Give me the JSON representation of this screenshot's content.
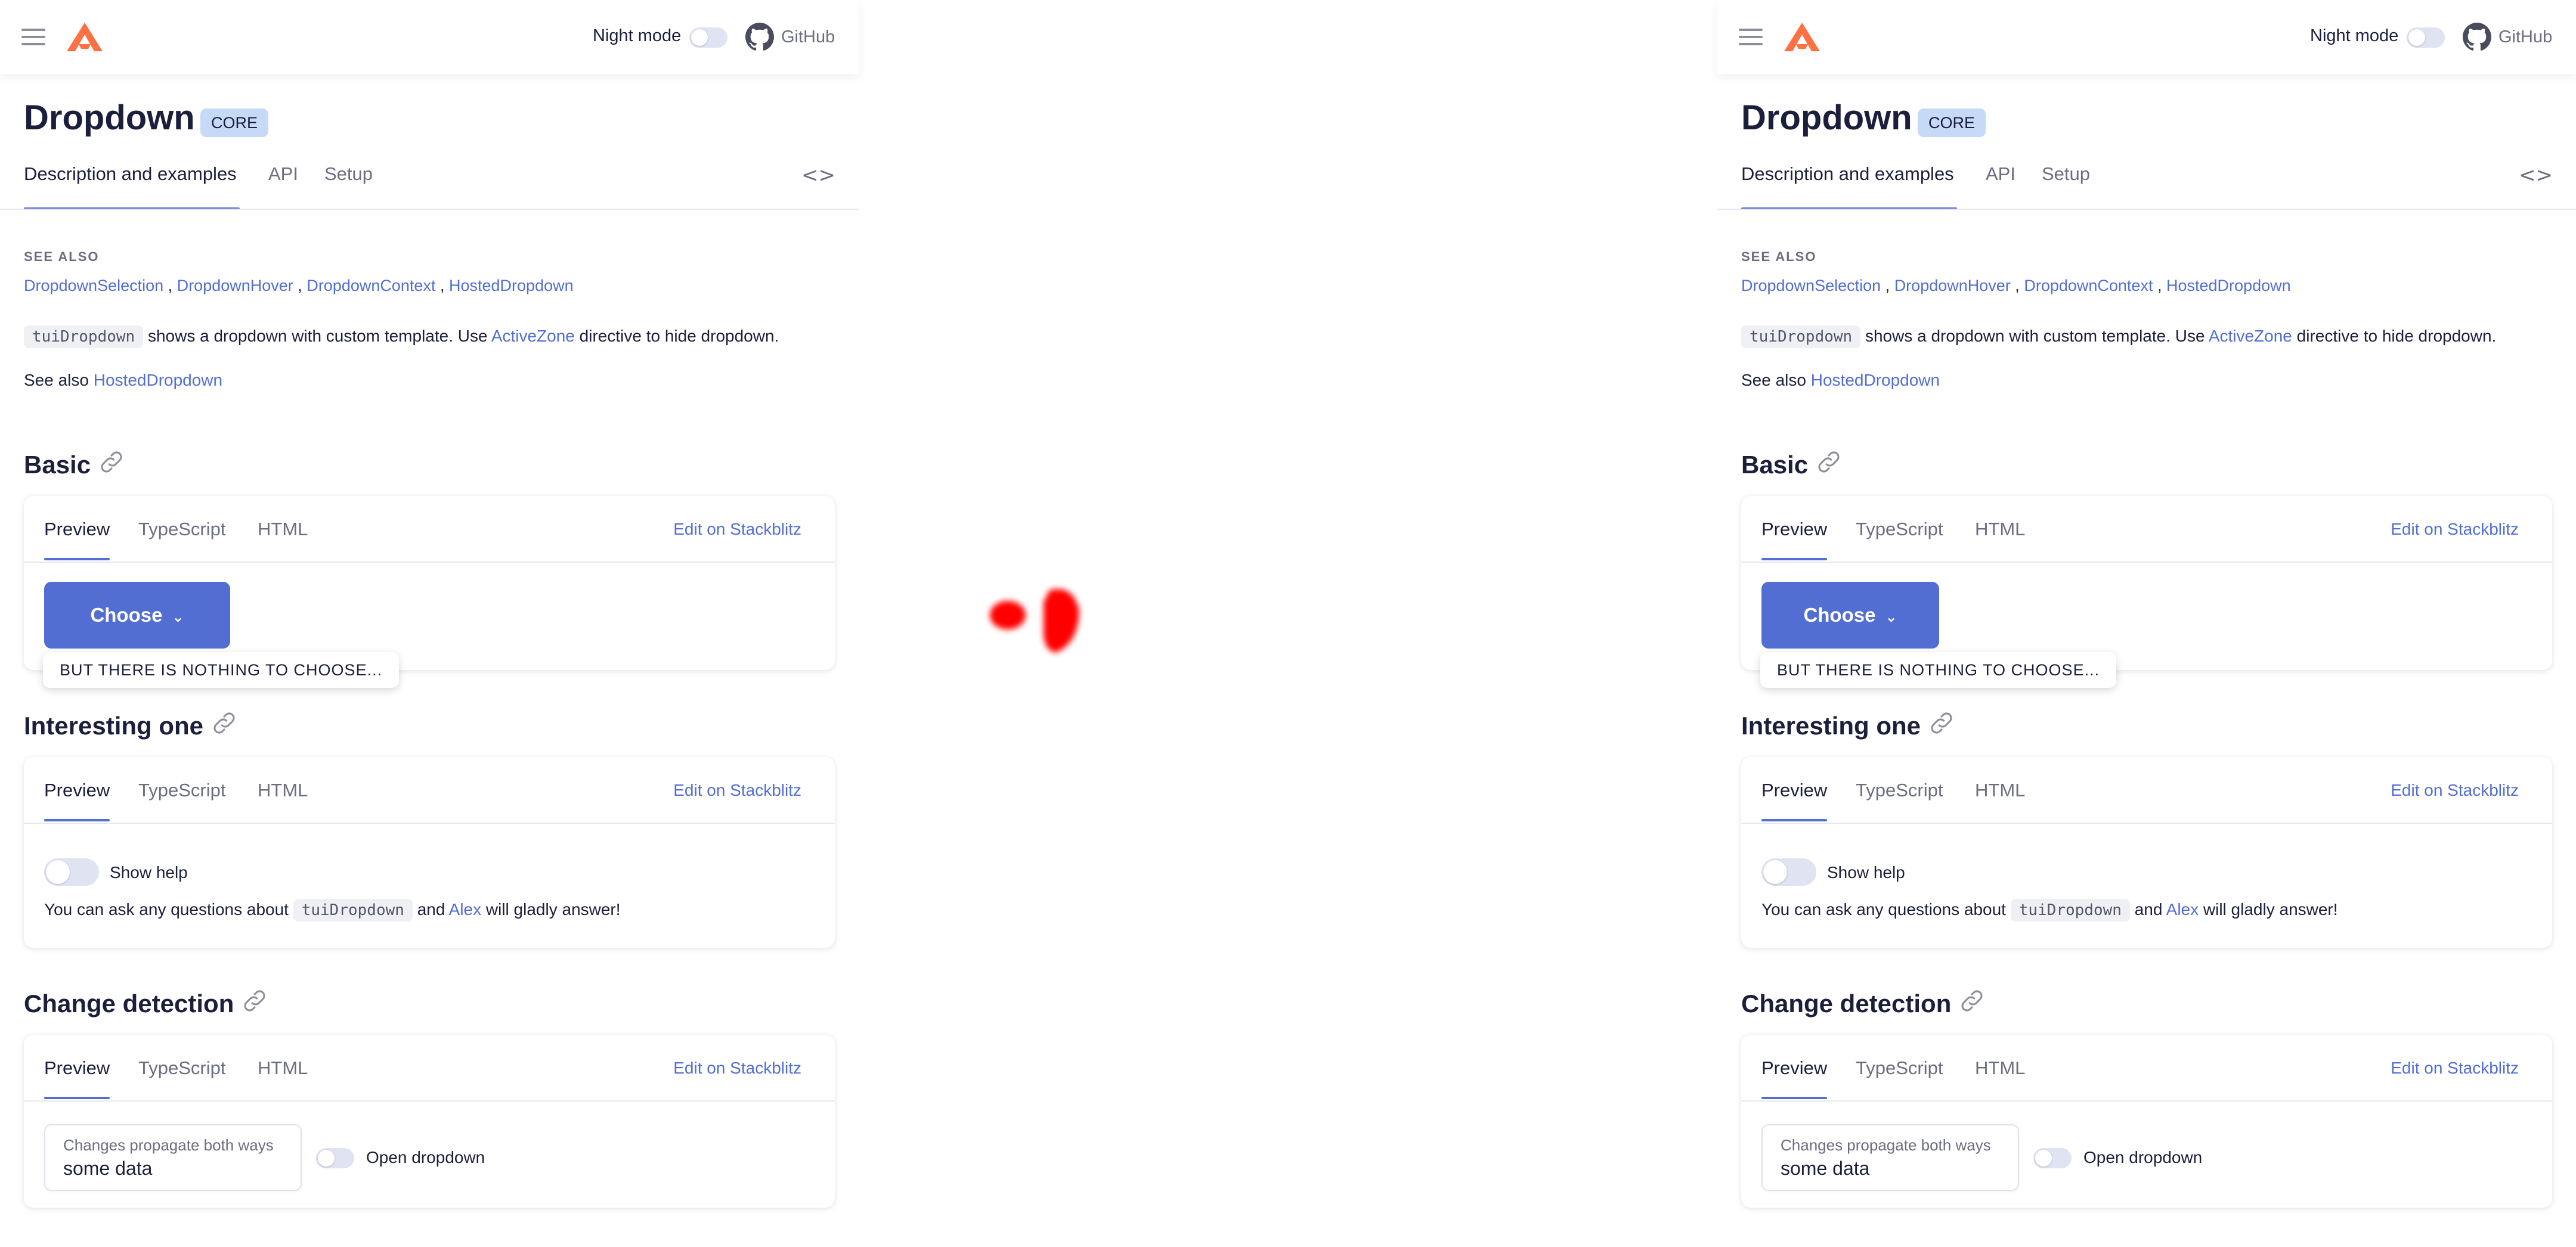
{
  "header": {
    "night_mode_label": "Night mode",
    "github_label": "GitHub"
  },
  "page": {
    "title": "Dropdown",
    "badge": "CORE",
    "tabs": [
      "Description and examples",
      "API",
      "Setup"
    ]
  },
  "see_also": {
    "heading": "SEE ALSO",
    "links": [
      "DropdownSelection",
      "DropdownHover",
      "DropdownContext",
      "HostedDropdown"
    ],
    "separator": ","
  },
  "description": {
    "code": "tuiDropdown",
    "text1": "shows a dropdown with custom template. Use",
    "link": "ActiveZone",
    "text2": "directive to hide dropdown.",
    "see_also_prefix": "See also",
    "see_also_link": "HostedDropdown"
  },
  "card_tabs": [
    "Preview",
    "TypeScript",
    "HTML"
  ],
  "stackblitz_label": "Edit on Stackblitz",
  "sections": {
    "basic": {
      "title": "Basic",
      "button_label": "Choose",
      "dropdown_text": "BUT THERE IS NOTHING TO CHOOSE..."
    },
    "interesting": {
      "title": "Interesting one",
      "toggle_label": "Show help",
      "text1": "You can ask any questions about",
      "code": "tuiDropdown",
      "text2": "and",
      "link": "Alex",
      "text3": "will gladly answer!"
    },
    "change": {
      "title": "Change detection",
      "input_label": "Changes propagate both ways",
      "input_value": "some data",
      "toggle_label": "Open dropdown"
    }
  },
  "colors": {
    "accent": "#526ed3",
    "badge": "#c6d9f6",
    "logo": "#ff7043",
    "mark": "#ff0000"
  }
}
